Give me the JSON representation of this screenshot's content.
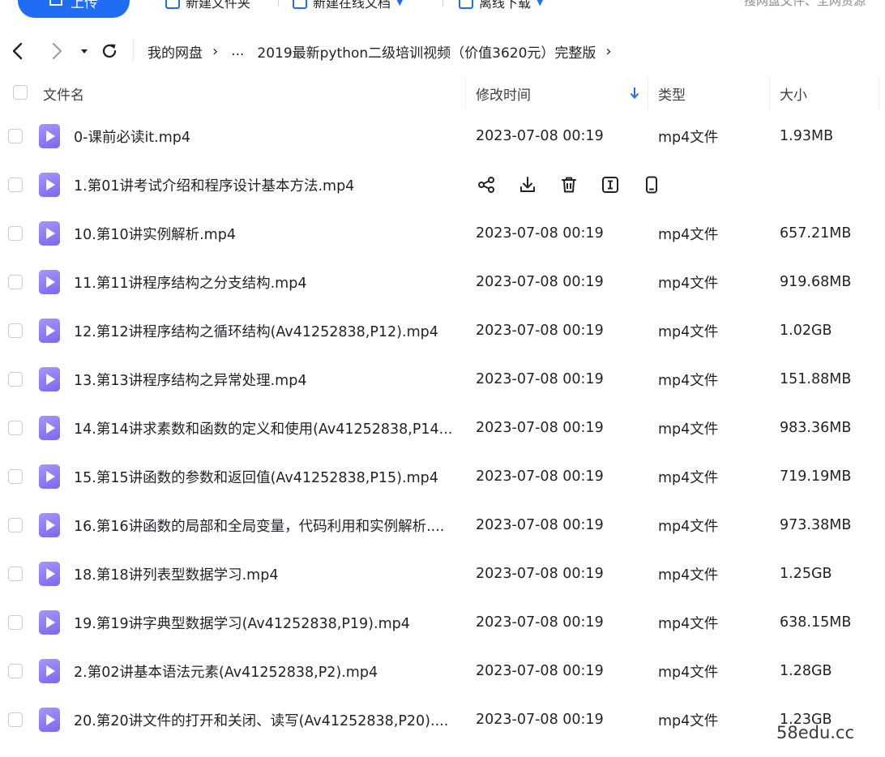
{
  "toolbar": {
    "upload_label": "上传",
    "new_folder_label": "新建文件夹",
    "new_online_doc_label": "新建在线文档",
    "offline_download_label": "离线下载",
    "search_placeholder": "搜网盘文件、全网资源"
  },
  "breadcrumb": {
    "root": "我的网盘",
    "ellipsis": "...",
    "current": "2019最新python二级培训视频（价值3620元）完整版"
  },
  "table": {
    "headers": {
      "name": "文件名",
      "modified": "修改时间",
      "type": "类型",
      "size": "大小"
    },
    "sort": {
      "column": "modified",
      "direction": "desc"
    },
    "rows": [
      {
        "name": "0-课前必读it.mp4",
        "modified": "2023-07-08 00:19",
        "type": "mp4文件",
        "size": "1.93MB"
      },
      {
        "name": "1.第01讲考试介绍和程序设计基本方法.mp4",
        "modified": "",
        "type": "",
        "size": "",
        "hovered": true
      },
      {
        "name": "10.第10讲实例解析.mp4",
        "modified": "2023-07-08 00:19",
        "type": "mp4文件",
        "size": "657.21MB"
      },
      {
        "name": "11.第11讲程序结构之分支结构.mp4",
        "modified": "2023-07-08 00:19",
        "type": "mp4文件",
        "size": "919.68MB"
      },
      {
        "name": "12.第12讲程序结构之循环结构(Av41252838,P12).mp4",
        "modified": "2023-07-08 00:19",
        "type": "mp4文件",
        "size": "1.02GB"
      },
      {
        "name": "13.第13讲程序结构之异常处理.mp4",
        "modified": "2023-07-08 00:19",
        "type": "mp4文件",
        "size": "151.88MB"
      },
      {
        "name": "14.第14讲求素数和函数的定义和使用(Av41252838,P14...",
        "modified": "2023-07-08 00:19",
        "type": "mp4文件",
        "size": "983.36MB"
      },
      {
        "name": "15.第15讲函数的参数和返回值(Av41252838,P15).mp4",
        "modified": "2023-07-08 00:19",
        "type": "mp4文件",
        "size": "719.19MB"
      },
      {
        "name": "16.第16讲函数的局部和全局变量，代码利用和实例解析....",
        "modified": "2023-07-08 00:19",
        "type": "mp4文件",
        "size": "973.38MB"
      },
      {
        "name": "18.第18讲列表型数据学习.mp4",
        "modified": "2023-07-08 00:19",
        "type": "mp4文件",
        "size": "1.25GB"
      },
      {
        "name": "19.第19讲字典型数据学习(Av41252838,P19).mp4",
        "modified": "2023-07-08 00:19",
        "type": "mp4文件",
        "size": "638.15MB"
      },
      {
        "name": "2.第02讲基本语法元素(Av41252838,P2).mp4",
        "modified": "2023-07-08 00:19",
        "type": "mp4文件",
        "size": "1.28GB"
      },
      {
        "name": "20.第20讲文件的打开和关闭、读写(Av41252838,P20)....",
        "modified": "2023-07-08 00:19",
        "type": "mp4文件",
        "size": "1.23GB"
      }
    ]
  },
  "row_actions": [
    "share-icon",
    "download-icon",
    "delete-icon",
    "rename-icon",
    "open-on-phone-icon"
  ],
  "watermark": "58edu.cc",
  "colors": {
    "accent": "#1f6cf5",
    "video_icon": "#8b78f0",
    "text": "#1f2329",
    "muted": "#8a8f99"
  }
}
